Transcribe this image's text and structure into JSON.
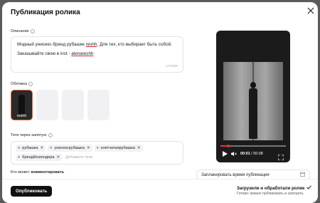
{
  "modal": {
    "title": "Публикация ролика"
  },
  "description": {
    "label": "Описание",
    "line1_before": "Модный унисекс-бренд рубашек ",
    "line1_brand": "reshh",
    "line1_after": ". Для тех, кто выбирает быть собой.",
    "line2_before": "Заказывайте свою в inst - ",
    "line2_handle": "alenareshh",
    "counter": "107/500"
  },
  "cover": {
    "label": "Обложка",
    "selected_caption": "reshh"
  },
  "tags": {
    "label": "Теги через запятую",
    "items": [
      "рубашка",
      "унисексрубашка",
      "клетчатаярубашка",
      "брендбезгендера"
    ],
    "placeholder": "Добавьте теги"
  },
  "who_can_comment": {
    "label_prefix": "Кто может ",
    "label_bold": "комментировать"
  },
  "video": {
    "current_time": "00:01",
    "separator": " / ",
    "duration": "00:08",
    "progress": 0.12
  },
  "schedule": {
    "label": "Запланировать время публикации"
  },
  "footer": {
    "publish_label": "Опубликовать",
    "status_title": "Загрузили и обработали ролик",
    "status_subtitle": "Готово: можно публиковать и смотреть"
  }
}
